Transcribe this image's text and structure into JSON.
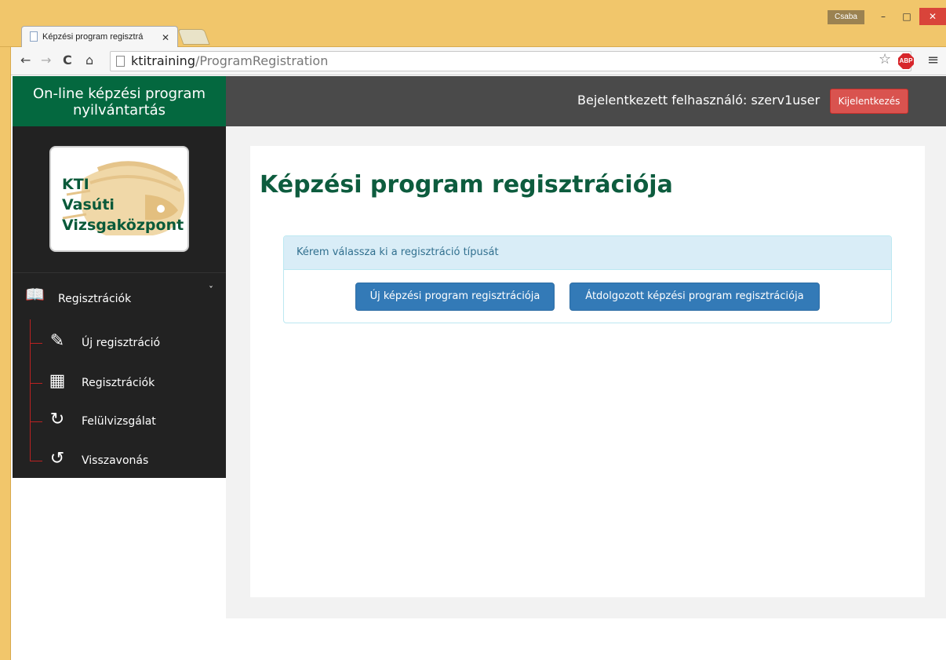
{
  "browser": {
    "tab_title": "Képzési program regisztrá",
    "tab_close": "✕",
    "window_user": "Csaba",
    "url_host": "ktitraining",
    "url_path": "/ProgramRegistration",
    "abp_label": "ABP"
  },
  "sidebar": {
    "brand": "On-line képzési program nyilvántartás",
    "logo_lines": [
      "KTI",
      "Vasúti",
      "Vizsgaközpont"
    ],
    "section_label": "Regisztrációk",
    "items": [
      {
        "label": "Új regisztráció",
        "icon": "edit-icon"
      },
      {
        "label": "Regisztrációk",
        "icon": "table-icon"
      },
      {
        "label": "Felülvizsgálat",
        "icon": "refresh-icon"
      },
      {
        "label": "Visszavonás",
        "icon": "undo-icon"
      }
    ]
  },
  "header": {
    "user_text": "Bejelentkezett felhasználó: szerv1user",
    "logout_label": "Kijelentkezés"
  },
  "main": {
    "title": "Képzési program regisztrációja",
    "panel_heading": "Kérem válassza ki a regisztráció típusát",
    "btn_new": "Új képzési program regisztrációja",
    "btn_reworked": "Átdolgozott képzési program regisztrációja"
  },
  "colors": {
    "brand_green": "#04683f",
    "sidebar_bg": "#222222",
    "topbar_bg": "#4a4a4a",
    "primary_blue": "#337ab7",
    "danger_red": "#d9534f"
  }
}
